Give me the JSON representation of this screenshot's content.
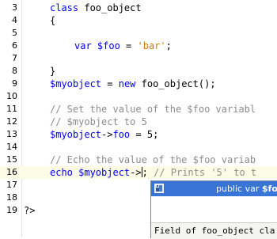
{
  "editor": {
    "lines": [
      {
        "n": "3"
      },
      {
        "n": "4"
      },
      {
        "n": "5"
      },
      {
        "n": "6"
      },
      {
        "n": "7"
      },
      {
        "n": "8"
      },
      {
        "n": "9"
      },
      {
        "n": "10"
      },
      {
        "n": "11"
      },
      {
        "n": "12"
      },
      {
        "n": "13"
      },
      {
        "n": "14"
      },
      {
        "n": "15"
      },
      {
        "n": "16"
      },
      {
        "n": "17"
      },
      {
        "n": "18"
      },
      {
        "n": "19"
      }
    ],
    "code": {
      "l3_kw": "class",
      "l3_name": " foo_object",
      "l4": "{",
      "l6_kw": "var",
      "l6_var": " $foo",
      "l6_eq": " = ",
      "l6_str": "'bar'",
      "l6_end": ";",
      "l8": "}",
      "l9_var": "$myobject",
      "l9_mid": " = ",
      "l9_kw": "new",
      "l9_rest": " foo_object();",
      "l11": "// Set the value of the $foo variabl",
      "l12": "// $myobject to 5",
      "l13_var": "$myobject",
      "l13_arrow": "->",
      "l13_prop": "foo",
      "l13_rest": " = 5;",
      "l15": "// Echo the value of the $foo variab",
      "l16_kw": "echo",
      "l16_var": " $myobject",
      "l16_arrow": "->",
      "l16_semi": ";",
      "l16_cm": " // Prints '5' to t",
      "l19": "?>"
    }
  },
  "completion": {
    "icon": "field-icon",
    "item_prefix": "public var ",
    "item_name": "$foo",
    "status": "Field of foo_object cla"
  }
}
